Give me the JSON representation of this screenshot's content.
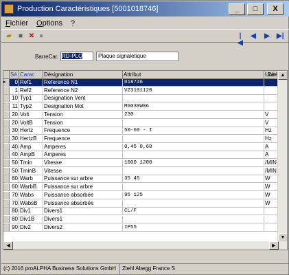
{
  "window": {
    "title": "Production Caractéristiques  [5001018746]",
    "minimize": "_",
    "maximize": "□",
    "close": "X"
  },
  "menu": [
    "Fichier",
    "Options",
    "?"
  ],
  "toolbar": {
    "icons": [
      "open-folder-icon",
      "save-icon",
      "delete-icon",
      "cancel-icon"
    ],
    "nav": [
      "|◀",
      "◀",
      "▶",
      "▶|"
    ]
  },
  "barcar": {
    "label": "BarreCar.",
    "value": "RD-PLQ",
    "description": "Plaque signaletique"
  },
  "grid": {
    "columns": [
      "Sé",
      "Carac",
      "Désignation",
      "Attribut",
      "Unité",
      "De"
    ],
    "rows": [
      {
        "seq": "0",
        "carac": "Ref1",
        "designation": "Reference N1",
        "attribut": "018746",
        "unite": "",
        "selected": true
      },
      {
        "seq": "1",
        "carac": "Ref2",
        "designation": "Reference N2",
        "attribut": "VZ3101120",
        "unite": "",
        "selected": false
      },
      {
        "seq": "10",
        "carac": "Typ1",
        "designation": "Designation Vent",
        "attribut": "",
        "unite": "",
        "selected": false
      },
      {
        "seq": "11",
        "carac": "Typ2",
        "designation": "Designation Mot",
        "attribut": "MG030W06",
        "unite": "",
        "selected": false
      },
      {
        "seq": "20",
        "carac": "Volt",
        "designation": "Tension",
        "attribut": "230",
        "unite": "V",
        "selected": false
      },
      {
        "seq": "20",
        "carac": "VoltB",
        "designation": "Tension",
        "attribut": "",
        "unite": "V",
        "selected": false
      },
      {
        "seq": "30",
        "carac": "Hertz",
        "designation": "Frequence",
        "attribut": "50-60 - I",
        "unite": "Hz",
        "selected": false
      },
      {
        "seq": "30",
        "carac": "HertzB",
        "designation": "Frequence",
        "attribut": "",
        "unite": "Hz",
        "selected": false
      },
      {
        "seq": "40",
        "carac": "Amp",
        "designation": "Amperes",
        "attribut": "0,45 0,60",
        "unite": "A",
        "selected": false
      },
      {
        "seq": "40",
        "carac": "AmpB",
        "designation": "Amperes",
        "attribut": "",
        "unite": "A",
        "selected": false
      },
      {
        "seq": "50",
        "carac": "Tmin",
        "designation": "Vitesse",
        "attribut": "1000 1200",
        "unite": "/MIN",
        "selected": false
      },
      {
        "seq": "50",
        "carac": "TminB",
        "designation": "Vitesse",
        "attribut": "",
        "unite": "/MIN",
        "selected": false
      },
      {
        "seq": "60",
        "carac": "Warb",
        "designation": "Puissance sur arbre",
        "attribut": "35 45",
        "unite": "W",
        "selected": false
      },
      {
        "seq": "60",
        "carac": "WarbB",
        "designation": "Puissance sur arbre",
        "attribut": "",
        "unite": "W",
        "selected": false
      },
      {
        "seq": "70",
        "carac": "Wabs",
        "designation": "Puissance absorbée",
        "attribut": "95 125",
        "unite": "W",
        "selected": false
      },
      {
        "seq": "70",
        "carac": "WabsB",
        "designation": "Puissance absorbée",
        "attribut": "",
        "unite": "W",
        "selected": false
      },
      {
        "seq": "80",
        "carac": "Div1",
        "designation": "Divers1",
        "attribut": "CL/F",
        "unite": "",
        "selected": false
      },
      {
        "seq": "80",
        "carac": "Div1B",
        "designation": "Divers1",
        "attribut": "",
        "unite": "",
        "selected": false
      },
      {
        "seq": "90",
        "carac": "Div2",
        "designation": "Divers2",
        "attribut": "IP55",
        "unite": "",
        "selected": false
      }
    ]
  },
  "status": [
    "(c) 2016 proALPHA Business Solutions GmbH",
    "Ziehl Abegg France S"
  ]
}
